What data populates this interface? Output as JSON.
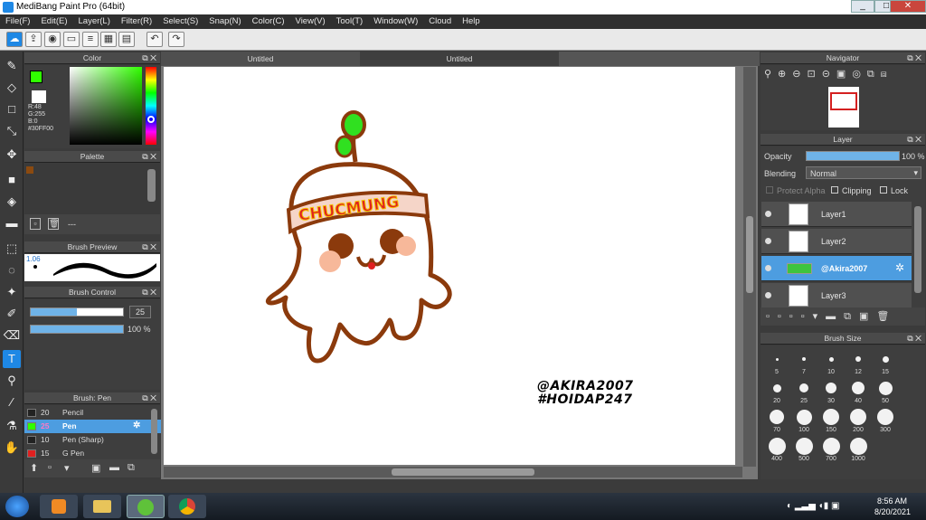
{
  "window": {
    "title": "MediBang Paint Pro (64bit)",
    "minimize": "_",
    "maximize": "□",
    "close": "✕"
  },
  "menu": [
    "File(F)",
    "Edit(E)",
    "Layer(L)",
    "Filter(R)",
    "Select(S)",
    "Snap(N)",
    "Color(C)",
    "View(V)",
    "Tool(T)",
    "Window(W)",
    "Cloud",
    "Help"
  ],
  "tabs": [
    "Untitled",
    "Untitled"
  ],
  "color_panel": {
    "title": "Color",
    "r": "R:48",
    "g": "G:255",
    "b": "B:0",
    "hex": "#30FF00",
    "accent": "#30ff00"
  },
  "palette": {
    "title": "Palette",
    "footer": "---"
  },
  "brush_preview": {
    "title": "Brush Preview",
    "size": "1.06"
  },
  "brush_control": {
    "title": "Brush Control",
    "size": "25",
    "opacity": "100 %"
  },
  "brush_list": {
    "title": "Brush: Pen",
    "items": [
      {
        "n": "20",
        "label": "Pencil",
        "color": "#222222"
      },
      {
        "n": "25",
        "label": "Pen",
        "color": "#30ff00",
        "selected": true
      },
      {
        "n": "10",
        "label": "Pen (Sharp)",
        "color": "#222222"
      },
      {
        "n": "15",
        "label": "G Pen",
        "color": "#e02020"
      }
    ]
  },
  "navigator": {
    "title": "Navigator"
  },
  "layer_panel": {
    "title": "Layer",
    "opacity_label": "Opacity",
    "opacity": "100 %",
    "blending_label": "Blending",
    "blending": "Normal",
    "protect_alpha": "Protect Alpha",
    "clipping": "Clipping",
    "lock": "Lock",
    "layers": [
      {
        "name": "Layer1"
      },
      {
        "name": "Layer2"
      },
      {
        "name": "@Akira2007",
        "selected": true
      },
      {
        "name": "Layer3"
      }
    ]
  },
  "brush_size": {
    "title": "Brush Size",
    "sizes": [
      "5",
      "7",
      "10",
      "12",
      "15",
      "20",
      "25",
      "30",
      "40",
      "50",
      "70",
      "100",
      "150",
      "200",
      "300",
      "400",
      "500",
      "700",
      "1000"
    ]
  },
  "artwork": {
    "headband": "CHUCMUNG",
    "watermark1": "@AKIRA2007",
    "watermark2": "#HOIDAP247"
  },
  "taskbar": {
    "time": "8:56 AM",
    "date": "8/20/2021"
  }
}
